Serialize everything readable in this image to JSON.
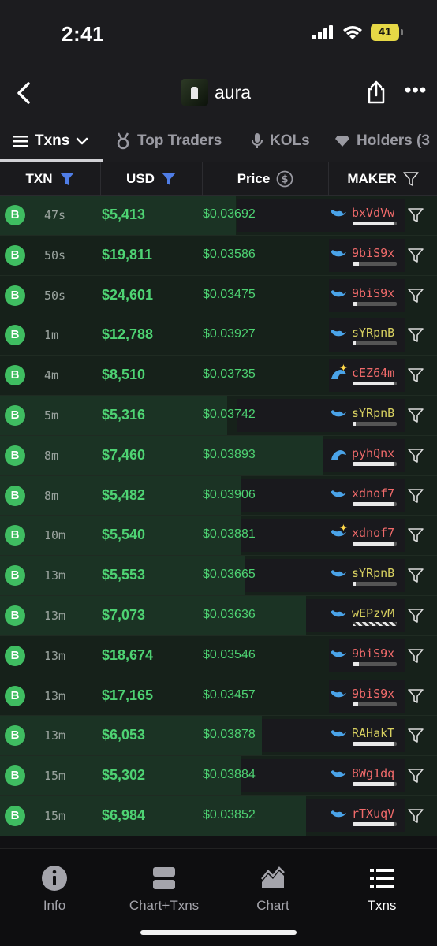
{
  "status": {
    "time": "2:41",
    "battery": "41"
  },
  "header": {
    "title": "aura"
  },
  "tabs": [
    {
      "label": "Txns"
    },
    {
      "label": "Top Traders"
    },
    {
      "label": "KOLs"
    },
    {
      "label": "Holders (3"
    }
  ],
  "columns": {
    "txn": "TXN",
    "usd": "USD",
    "price": "Price",
    "maker": "MAKER"
  },
  "colors": {
    "buy": "#4ed373",
    "badge": "#3fbd61",
    "accent_filter": "#4f7de6"
  },
  "rows": [
    {
      "type": "B",
      "age": "47s",
      "usd": "$5,413",
      "price": "$0.03692",
      "maker": "bxVdVw",
      "maker_color": "#f06a6a",
      "icon": "whale-icon",
      "bar_pct": 95,
      "bg_pct": 54
    },
    {
      "type": "B",
      "age": "50s",
      "usd": "$19,811",
      "price": "$0.03586",
      "maker": "9biS9x",
      "maker_color": "#f06a6a",
      "icon": "whale-icon",
      "bar_pct": 15,
      "bg_pct": 0
    },
    {
      "type": "B",
      "age": "50s",
      "usd": "$24,601",
      "price": "$0.03475",
      "maker": "9biS9x",
      "maker_color": "#f06a6a",
      "icon": "whale-icon",
      "bar_pct": 10,
      "bg_pct": 0
    },
    {
      "type": "B",
      "age": "1m",
      "usd": "$12,788",
      "price": "$0.03927",
      "maker": "sYRpnB",
      "maker_color": "#d8d060",
      "icon": "whale-icon",
      "bar_pct": 8,
      "bg_pct": 0
    },
    {
      "type": "B",
      "age": "4m",
      "usd": "$8,510",
      "price": "$0.03735",
      "maker": "cEZ64m",
      "maker_color": "#f06a6a",
      "icon": "dolphin-sparkle-icon",
      "bar_pct": 95,
      "bg_pct": 0
    },
    {
      "type": "B",
      "age": "5m",
      "usd": "$5,316",
      "price": "$0.03742",
      "maker": "sYRpnB",
      "maker_color": "#d8d060",
      "icon": "whale-icon",
      "bar_pct": 8,
      "bg_pct": 52
    },
    {
      "type": "B",
      "age": "8m",
      "usd": "$7,460",
      "price": "$0.03893",
      "maker": "pyhQnx",
      "maker_color": "#f06a6a",
      "icon": "dolphin-icon",
      "bar_pct": 95,
      "bg_pct": 74
    },
    {
      "type": "B",
      "age": "8m",
      "usd": "$5,482",
      "price": "$0.03906",
      "maker": "xdnof7",
      "maker_color": "#f06a6a",
      "icon": "whale-icon",
      "bar_pct": 95,
      "bg_pct": 55
    },
    {
      "type": "B",
      "age": "10m",
      "usd": "$5,540",
      "price": "$0.03881",
      "maker": "xdnof7",
      "maker_color": "#f06a6a",
      "icon": "whale-sparkle-icon",
      "bar_pct": 95,
      "bg_pct": 55
    },
    {
      "type": "B",
      "age": "13m",
      "usd": "$5,553",
      "price": "$0.03665",
      "maker": "sYRpnB",
      "maker_color": "#d8d060",
      "icon": "whale-icon",
      "bar_pct": 8,
      "bg_pct": 56
    },
    {
      "type": "B",
      "age": "13m",
      "usd": "$7,073",
      "price": "$0.03636",
      "maker": "wEPzvM",
      "maker_color": "#d8d060",
      "icon": "whale-icon",
      "bar_pct": 100,
      "bg_pct": 70,
      "striped": true
    },
    {
      "type": "B",
      "age": "13m",
      "usd": "$18,674",
      "price": "$0.03546",
      "maker": "9biS9x",
      "maker_color": "#f06a6a",
      "icon": "whale-icon",
      "bar_pct": 15,
      "bg_pct": 0
    },
    {
      "type": "B",
      "age": "13m",
      "usd": "$17,165",
      "price": "$0.03457",
      "maker": "9biS9x",
      "maker_color": "#f06a6a",
      "icon": "whale-icon",
      "bar_pct": 12,
      "bg_pct": 0
    },
    {
      "type": "B",
      "age": "13m",
      "usd": "$6,053",
      "price": "$0.03878",
      "maker": "RAHakT",
      "maker_color": "#d8d060",
      "icon": "whale-icon",
      "bar_pct": 95,
      "bg_pct": 60
    },
    {
      "type": "B",
      "age": "15m",
      "usd": "$5,302",
      "price": "$0.03884",
      "maker": "8Wg1dq",
      "maker_color": "#f06a6a",
      "icon": "whale-icon",
      "bar_pct": 95,
      "bg_pct": 55
    },
    {
      "type": "B",
      "age": "15m",
      "usd": "$6,984",
      "price": "$0.03852",
      "maker": "rTXuqV",
      "maker_color": "#f06a6a",
      "icon": "whale-icon",
      "bar_pct": 95,
      "bg_pct": 70
    }
  ],
  "bottom_nav": [
    {
      "label": "Info",
      "icon": "info-icon"
    },
    {
      "label": "Chart+Txns",
      "icon": "split-view-icon"
    },
    {
      "label": "Chart",
      "icon": "chart-icon"
    },
    {
      "label": "Txns",
      "icon": "list-icon",
      "active": true
    }
  ]
}
